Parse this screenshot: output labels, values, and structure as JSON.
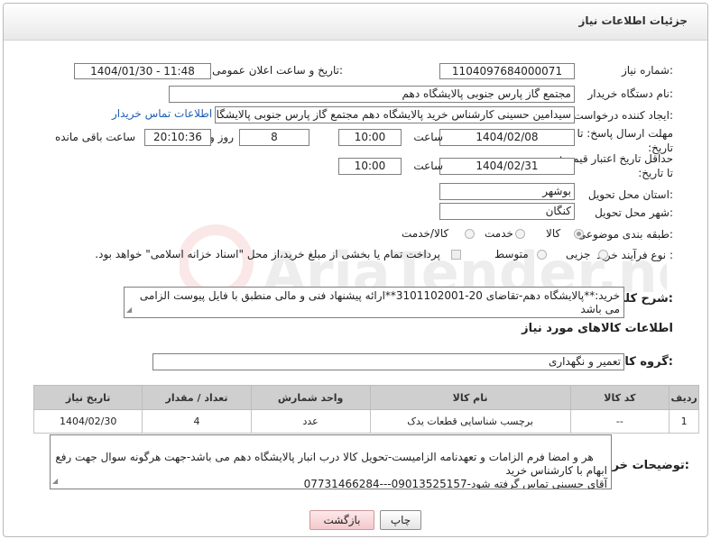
{
  "header": {
    "title": "جزئیات اطلاعات نیاز"
  },
  "labels": {
    "need_number": "شماره نیاز:",
    "announce_datetime": "تاریخ و ساعت اعلان عمومی:",
    "buyer_org": "نام دستگاه خریدار:",
    "requester": "ایجاد کننده درخواست:",
    "reply_deadline": "مهلت ارسال پاسخ: تا تاریخ:",
    "price_validity": "حداقل تاریخ اعتبار قیمت: تا تاریخ:",
    "time": "ساعت",
    "days_and": "روز و",
    "remaining": "ساعت باقی مانده",
    "province": "استان محل تحویل:",
    "city": "شهر محل تحویل:",
    "category": "طبقه بندی موضوعی:",
    "process_type": "نوع فرآیند خرید :",
    "description": "شرح کلی نیاز:",
    "goods_info": "اطلاعات کالاهای مورد نیاز",
    "goods_group": "گروه کالا:",
    "buyer_notes": "توضیحات خریدار:"
  },
  "fields": {
    "need_number": "1104097684000071",
    "announce_datetime": "1404/01/30 - 11:48",
    "buyer_org": "مجتمع گاز پارس جنوبی  پالایشگاه دهم",
    "requester": "سیدامین حسینی کارشناس خرید پالایشگاه دهم  مجتمع گاز پارس جنوبی  پالایشگاه دهم",
    "contact_link": "اطلاعات تماس خریدار",
    "reply_date": "1404/02/08",
    "reply_time": "10:00",
    "days": "8",
    "remaining_time": "20:10:36",
    "validity_date": "1404/02/31",
    "validity_time": "10:00",
    "province": "بوشهر",
    "city": "کنگان",
    "goods_group": "تعمیر و نگهداری"
  },
  "category_options": [
    "کالا",
    "خدمت",
    "کالا/خدمت"
  ],
  "process_options": [
    "جزیی",
    "متوسط"
  ],
  "payment_note": "پرداخت تمام یا بخشی از مبلغ خرید،از محل \"اسناد خزانه اسلامی\" خواهد بود.",
  "description": "خرید:**پالایشگاه دهم-تقاضای 20-3101102001**ارائه پیشنهاد فنی و مالی منطبق با فایل پیوست الزامی می باشد",
  "table": {
    "headers": [
      "ردیف",
      "کد کالا",
      "نام کالا",
      "واحد شمارش",
      "تعداد / مقدار",
      "تاریخ نیاز"
    ],
    "rows": [
      [
        "1",
        "--",
        "برچسب شناسایی قطعات یدک",
        "عدد",
        "4",
        "1404/02/30"
      ]
    ]
  },
  "buyer_notes": "هر و امضا فرم الزامات و تعهدنامه الزامیست-تحویل کالا درب انبار پالایشگاه دهم می باشد-جهت هرگونه سوال جهت رفع ابهام با کارشناس خرید\nآقای حسینی تماس گرفته شود-09013525157---07731466284",
  "buttons": {
    "print": "چاپ",
    "back": "بازگشت"
  },
  "watermark": "AriaTender.neT"
}
